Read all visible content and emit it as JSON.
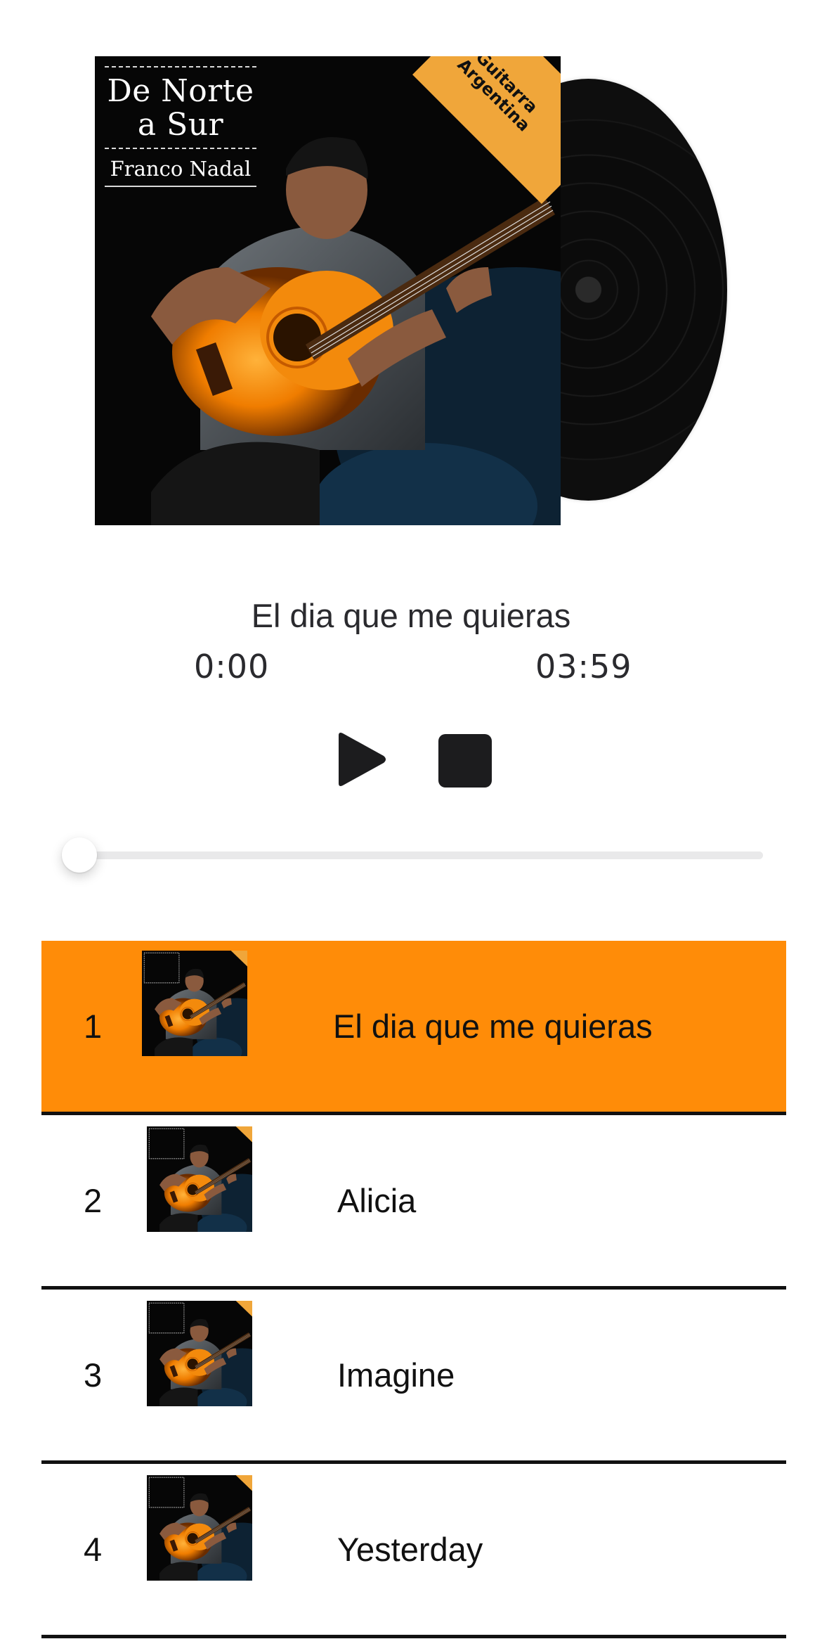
{
  "album": {
    "title": "De Norte a Sur",
    "artist": "Franco Nadal",
    "badge": "Guitarra Argentina"
  },
  "player": {
    "now_playing": "El dia que me quieras",
    "current_time": "0:00",
    "total_time": "03:59",
    "progress": 0,
    "play_icon": "play-icon",
    "stop_icon": "stop-icon"
  },
  "tracks": [
    {
      "number": "1",
      "title": "El dia que me quieras",
      "active": true
    },
    {
      "number": "2",
      "title": "Alicia",
      "active": false
    },
    {
      "number": "3",
      "title": "Imagine",
      "active": false
    },
    {
      "number": "4",
      "title": "Yesterday",
      "active": false
    }
  ],
  "colors": {
    "accent": "#ff8c08",
    "badge": "#f0a63a",
    "text": "#2a2a2e",
    "divider": "#111111"
  }
}
